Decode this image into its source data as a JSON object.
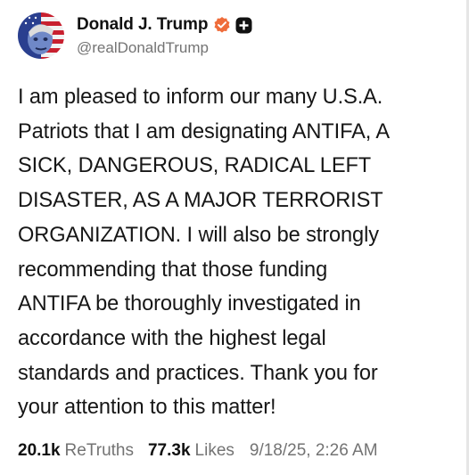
{
  "post": {
    "author": {
      "display_name": "Donald J. Trump",
      "handle": "@realDonaldTrump",
      "verified_icon": "verified-badge-icon",
      "follow_icon": "plus-icon",
      "accent_color": "#ef6c3a"
    },
    "text": "I am pleased to inform our many U.S.A.\nPatriots that I am designating ANTIFA, A\nSICK, DANGEROUS, RADICAL LEFT\nDISASTER, AS A MAJOR TERRORIST\nORGANIZATION. I will also be strongly\nrecommending that those funding\nANTIFA be thoroughly investigated in\naccordance with the highest legal\nstandards and practices. Thank you for\nyour attention to this matter!",
    "stats": {
      "retruths_count": "20.1k",
      "retruths_label": "ReTruths",
      "likes_count": "77.3k",
      "likes_label": "Likes"
    },
    "timestamp": "9/18/25, 2:26 AM"
  }
}
